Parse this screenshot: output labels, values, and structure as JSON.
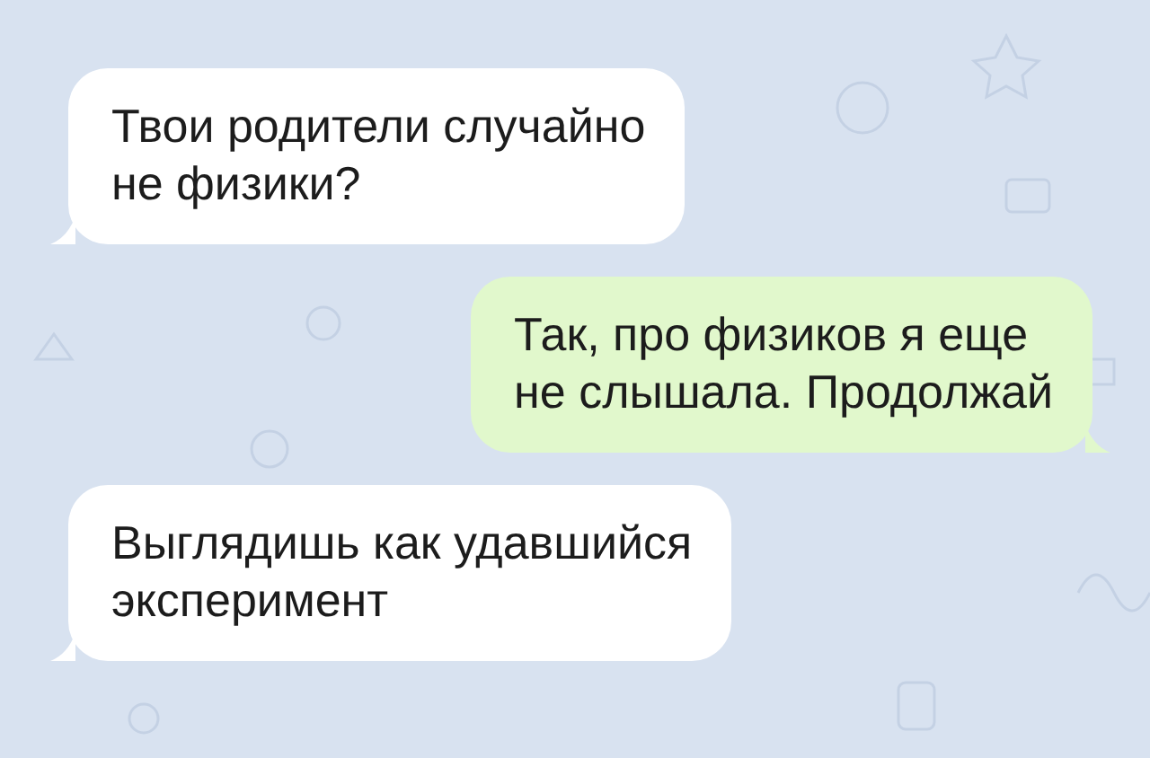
{
  "messages": [
    {
      "kind": "incoming",
      "text": "Твои родители случайно\nне физики?"
    },
    {
      "kind": "outgoing",
      "text": "Так, про физиков я еще\nне слышала. Продолжай"
    },
    {
      "kind": "incoming",
      "text": "Выглядишь как удавшийся\nэксперимент"
    }
  ]
}
